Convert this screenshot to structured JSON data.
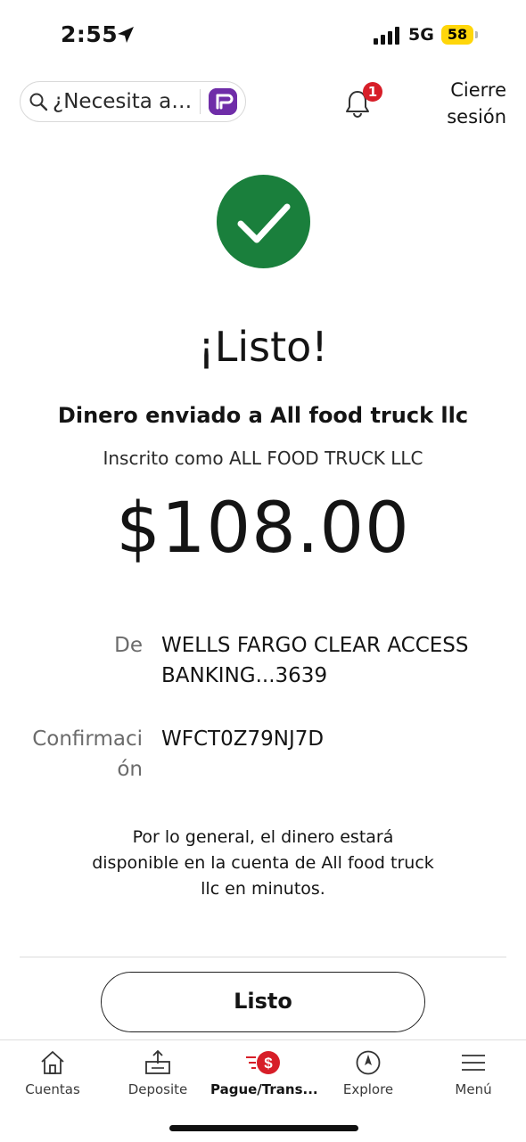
{
  "status_bar": {
    "time": "2:55",
    "network": "5G",
    "battery": "58",
    "battery_color": "#ffd60a"
  },
  "header": {
    "search_placeholder": "¿Necesita a…",
    "notification_count": "1",
    "signout_line1": "Cierre",
    "signout_line2": "sesión"
  },
  "confirmation": {
    "status_icon": "check-circle-icon",
    "success_color": "#1a7f3c",
    "title": "¡Listo!",
    "subtitle": "Dinero enviado a All food truck llc",
    "enrolled_as": "Inscrito como ALL FOOD TRUCK LLC",
    "amount": "$108.00"
  },
  "details": {
    "from_label": "De",
    "from_line1": "WELLS FARGO CLEAR ACCESS",
    "from_line2": "BANKING...3639",
    "confirmation_label_line1": "Confirmaci",
    "confirmation_label_line2": "ón",
    "confirmation_value": "WFCT0Z79NJ7D"
  },
  "note": {
    "line1": "Por lo general, el dinero estará",
    "line2": "disponible en la cuenta de All food truck",
    "line3": "llc en minutos."
  },
  "done_button": "Listo",
  "tabs": [
    {
      "label": "Cuentas",
      "icon": "home-icon",
      "active": false
    },
    {
      "label": "Deposite",
      "icon": "deposit-icon",
      "active": false
    },
    {
      "label": "Pague/Trans...",
      "icon": "pay-transfer-icon",
      "active": true
    },
    {
      "label": "Explore",
      "icon": "compass-icon",
      "active": false
    },
    {
      "label": "Menú",
      "icon": "menu-icon",
      "active": false
    }
  ],
  "colors": {
    "brand_red": "#d71e28",
    "fargo_purple": "#6f2da8"
  }
}
